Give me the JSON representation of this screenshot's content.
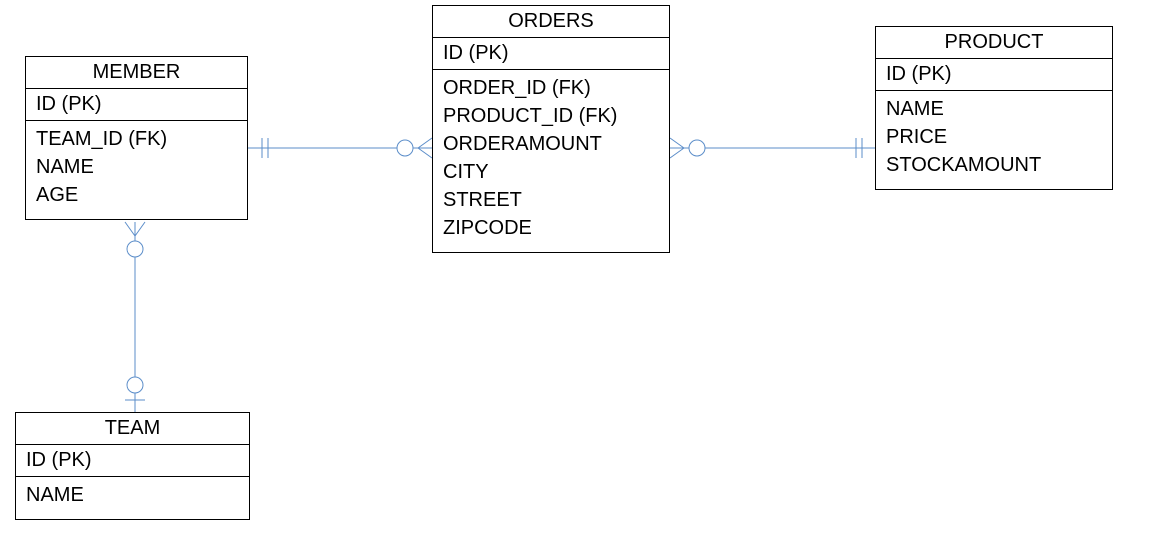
{
  "entities": {
    "member": {
      "title": "MEMBER",
      "pk": "ID (PK)",
      "attrs": [
        "TEAM_ID (FK)",
        "NAME",
        "AGE"
      ]
    },
    "orders": {
      "title": "ORDERS",
      "pk": "ID (PK)",
      "attrs": [
        "ORDER_ID (FK)",
        "PRODUCT_ID (FK)",
        "ORDERAMOUNT",
        "CITY",
        "STREET",
        "ZIPCODE"
      ]
    },
    "product": {
      "title": "PRODUCT",
      "pk": "ID (PK)",
      "attrs": [
        "NAME",
        "PRICE",
        "STOCKAMOUNT"
      ]
    },
    "team": {
      "title": "TEAM",
      "pk": "ID (PK)",
      "attrs": [
        "NAME"
      ]
    }
  },
  "relationships": [
    {
      "from": "member",
      "to": "orders",
      "type": "one-to-many-optional"
    },
    {
      "from": "product",
      "to": "orders",
      "type": "one-to-many-optional"
    },
    {
      "from": "team",
      "to": "member",
      "type": "one-to-many-optional"
    }
  ]
}
